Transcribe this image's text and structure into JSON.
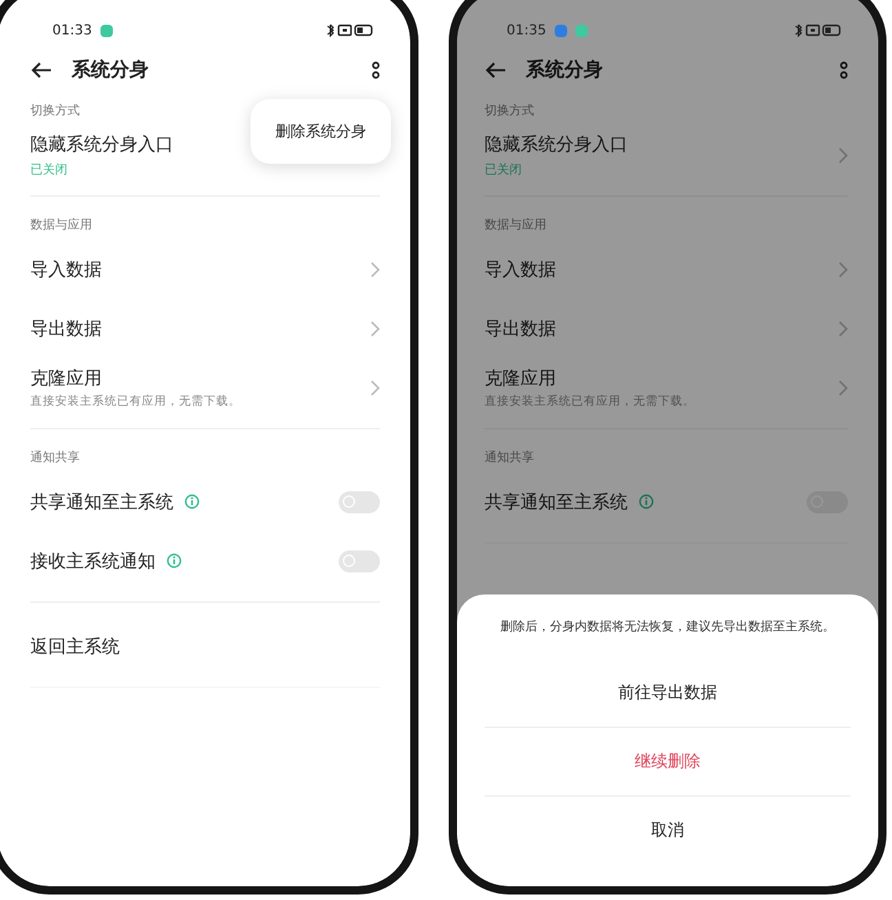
{
  "screens": [
    {
      "status_bar": {
        "time": "01:33",
        "notifications": [
          {
            "color": "#3ec9a0"
          }
        ]
      },
      "header": {
        "title": "系统分身"
      },
      "popup_menu": {
        "items": [
          "删除系统分身"
        ]
      },
      "sections": [
        {
          "title": "切换方式",
          "items": [
            {
              "kind": "link",
              "label": "隐藏系统分身入口",
              "status": "已关闭"
            }
          ]
        },
        {
          "title": "数据与应用",
          "items": [
            {
              "kind": "link",
              "label": "导入数据"
            },
            {
              "kind": "link",
              "label": "导出数据"
            },
            {
              "kind": "link",
              "label": "克隆应用",
              "subtitle": "直接安装主系统已有应用，无需下载。"
            }
          ]
        },
        {
          "title": "通知共享",
          "items": [
            {
              "kind": "toggle",
              "label": "共享通知至主系统",
              "on": false
            },
            {
              "kind": "toggle",
              "label": "接收主系统通知",
              "on": false
            }
          ]
        },
        {
          "items": [
            {
              "kind": "plain",
              "label": "返回主系统"
            }
          ]
        }
      ]
    },
    {
      "status_bar": {
        "time": "01:35",
        "notifications": [
          {
            "color": "#2f7de1"
          },
          {
            "color": "#3ec9a0"
          }
        ]
      },
      "header": {
        "title": "系统分身"
      },
      "dimmed": true,
      "sections": [
        {
          "title": "切换方式",
          "items": [
            {
              "kind": "link",
              "label": "隐藏系统分身入口",
              "status": "已关闭"
            }
          ]
        },
        {
          "title": "数据与应用",
          "items": [
            {
              "kind": "link",
              "label": "导入数据"
            },
            {
              "kind": "link",
              "label": "导出数据"
            },
            {
              "kind": "link",
              "label": "克隆应用",
              "subtitle": "直接安装主系统已有应用，无需下载。"
            }
          ]
        },
        {
          "title": "通知共享",
          "items": [
            {
              "kind": "toggle",
              "label": "共享通知至主系统",
              "on": false
            }
          ]
        }
      ],
      "sheet": {
        "message": "删除后，分身内数据将无法恢复，建议先导出数据至主系统。",
        "actions": [
          {
            "label": "前往导出数据",
            "kind": "normal"
          },
          {
            "label": "继续删除",
            "kind": "destructive"
          },
          {
            "label": "取消",
            "kind": "normal"
          }
        ]
      }
    }
  ]
}
